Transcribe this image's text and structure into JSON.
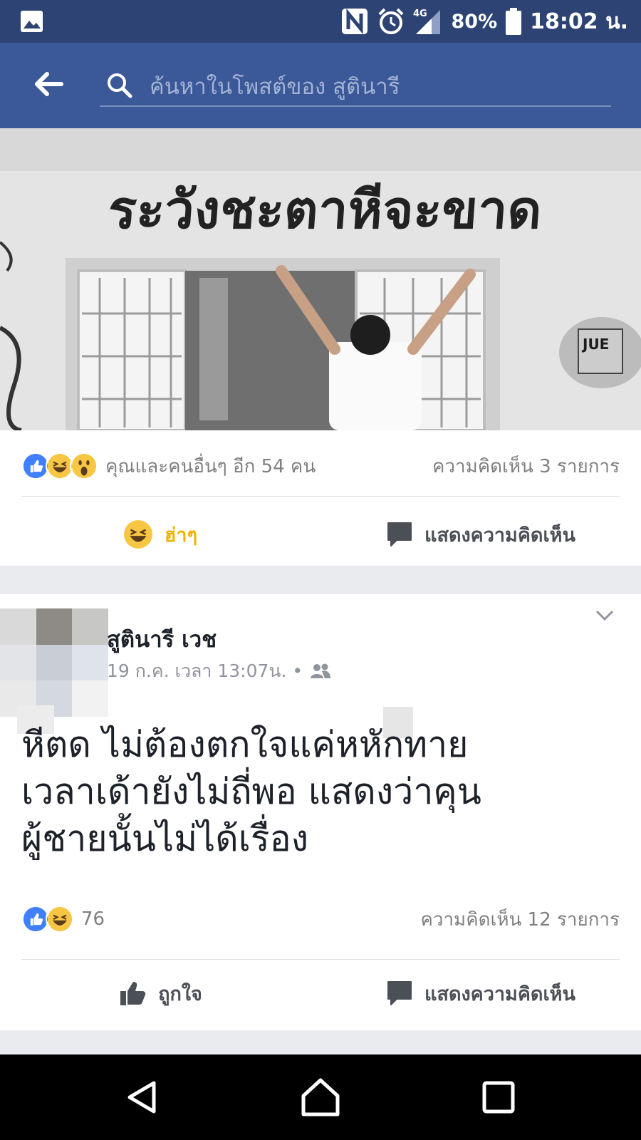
{
  "status_bar": {
    "battery": "80%",
    "time": "18:02 น.",
    "network": "4G"
  },
  "search": {
    "placeholder": "ค้นหาในโพสต์ของ สูตินารี"
  },
  "card1": {
    "reactions_text": "คุณและคนอื่นๆ อีก 54 คน",
    "comments_text": "ความคิดเห็น 3 รายการ",
    "haha_label": "ฮ่าๆ",
    "comment_label": "แสดงความคิดเห็น",
    "photo_graffiti": "ระวังชะตาหีจะขาด"
  },
  "card2": {
    "author": "สูตินารี เวช",
    "meta": "19 ก.ค. เวลา 13:07น. •",
    "text_lines": [
      "หีตด ไม่ต้องตกใจแค่หหักทาย",
      "เวลาเด้ายังไม่ถี่พอ แสดงว่าคุน",
      "ผู้ชายนั้นไม่ได้เรื่อง"
    ],
    "likes": "76",
    "comments_text": "ความคิดเห็น 12 รายการ",
    "like_label": "ถูกใจ",
    "comment_label": "แสดงความคิดเห็น"
  },
  "colors": {
    "status_bar": "#2c4373",
    "header": "#3b5998",
    "like_blue": "#4080ff",
    "haha_yellow": "#f7c744",
    "haha_text": "#f0b400"
  },
  "icons": [
    "gallery-icon",
    "nfc-icon",
    "alarm-icon",
    "signal-icon",
    "battery-icon",
    "back-arrow-icon",
    "search-icon",
    "like-reaction-icon",
    "haha-reaction-icon",
    "wow-reaction-icon",
    "comment-icon",
    "thumbs-up-icon",
    "chevron-down-icon",
    "friends-icon",
    "back-triangle-icon",
    "home-icon",
    "recents-icon"
  ]
}
